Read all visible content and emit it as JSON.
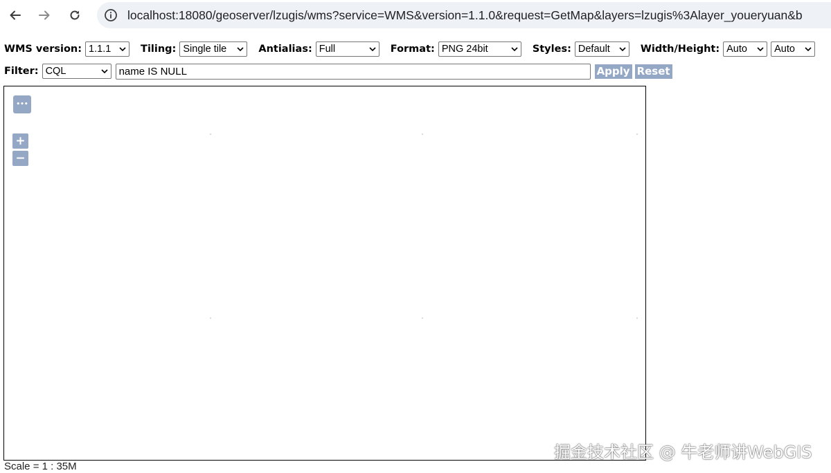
{
  "browser": {
    "url": "localhost:18080/geoserver/lzugis/wms?service=WMS&version=1.1.0&request=GetMap&layers=lzugis%3Alayer_youeryuan&b"
  },
  "toolbar": {
    "wms_version": {
      "label": "WMS version:",
      "value": "1.1.1"
    },
    "tiling": {
      "label": "Tiling:",
      "value": "Single tile"
    },
    "antialias": {
      "label": "Antialias:",
      "value": "Full"
    },
    "format": {
      "label": "Format:",
      "value": "PNG 24bit"
    },
    "styles": {
      "label": "Styles:",
      "value": "Default"
    },
    "width_height": {
      "label": "Width/Height:",
      "width_value": "Auto",
      "height_value": "Auto"
    },
    "filter": {
      "label": "Filter:",
      "type_value": "CQL",
      "expression": "name IS NULL"
    },
    "apply_label": "Apply",
    "reset_label": "Reset"
  },
  "map": {
    "more_glyph": "•••",
    "zoom_in_glyph": "+",
    "zoom_out_glyph": "−",
    "scale_text": "Scale = 1 : 35M"
  },
  "watermark": "掘金技术社区 @ 牛老师讲WebGIS",
  "colors": {
    "control_bg": "#94a8c6",
    "address_bg": "#eef1f6"
  }
}
